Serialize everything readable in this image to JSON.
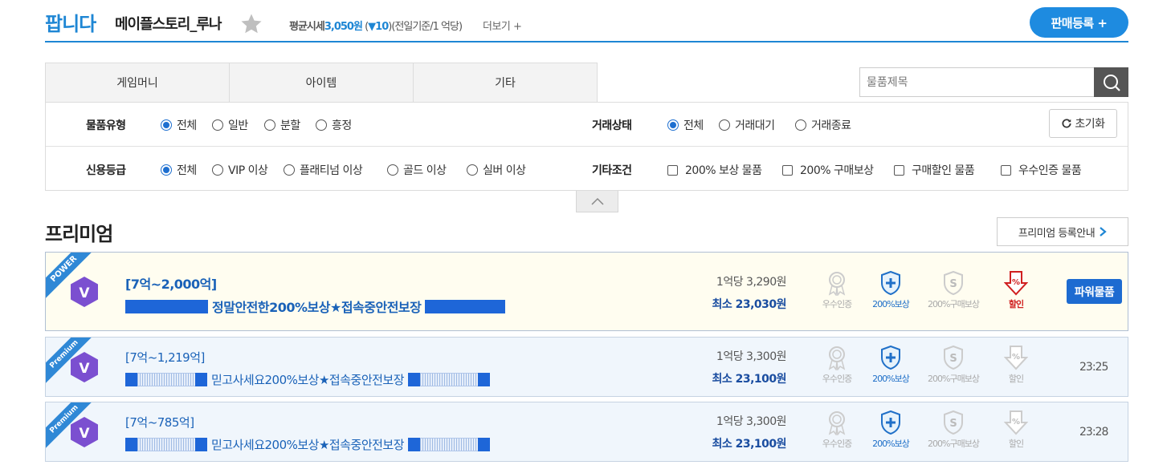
{
  "header": {
    "title": "팝니다",
    "game": "메이플스토리_루나",
    "avg_label": "평균시세",
    "avg_price": "3,050원",
    "avg_change": "▼10",
    "avg_note": "(전일기준/1 억당)",
    "more": "더보기 +",
    "sell_button": "판매등록 +"
  },
  "tabs": [
    "게임머니",
    "아이템",
    "기타"
  ],
  "search": {
    "placeholder": "물품제목"
  },
  "filters": {
    "type": {
      "label": "물품유형",
      "options": [
        "전체",
        "일반",
        "분할",
        "흥정"
      ],
      "selected": 0
    },
    "status": {
      "label": "거래상태",
      "options": [
        "전체",
        "거래대기",
        "거래종료"
      ],
      "selected": 0
    },
    "credit": {
      "label": "신용등급",
      "options": [
        "전체",
        "VIP 이상",
        "플래티넘 이상",
        "골드 이상",
        "실버 이상"
      ],
      "selected": 0
    },
    "etc": {
      "label": "기타조건",
      "options": [
        "200% 보상 물품",
        "200% 구매보상",
        "구매할인 물품",
        "우수인증 물품"
      ]
    },
    "reset": "초기화"
  },
  "premium": {
    "title": "프리미엄",
    "guide": "프리미엄 등록안내",
    "icon_labels": [
      "우수인증",
      "200%보상",
      "200%구매보상",
      "할인"
    ],
    "rows": [
      {
        "kind": "power",
        "ribbon": "POWER",
        "badge": "V",
        "range": "[7억~2,000억]",
        "title": "정말안전한200%보상★접속중안전보장",
        "per": "1억당 3,290원",
        "min": "최소 23,030원",
        "action": "파워물품"
      },
      {
        "kind": "premium",
        "ribbon": "Premium",
        "badge": "V",
        "range": "[7억~1,219억]",
        "title": "믿고사세요200%보상★접속중안전보장",
        "per": "1억당 3,300원",
        "min": "최소 23,100원",
        "time": "23:25"
      },
      {
        "kind": "premium",
        "ribbon": "Premium",
        "badge": "V",
        "range": "[7억~785억]",
        "title": "믿고사세요200%보상★접속중안전보장",
        "per": "1억당 3,300원",
        "min": "최소 23,100원",
        "time": "23:28"
      }
    ]
  },
  "colors": {
    "accent": "#1e86d4",
    "title_blue": "#1a62b8",
    "badge_purple": "#7b4fd0",
    "discount_red": "#d02020"
  }
}
